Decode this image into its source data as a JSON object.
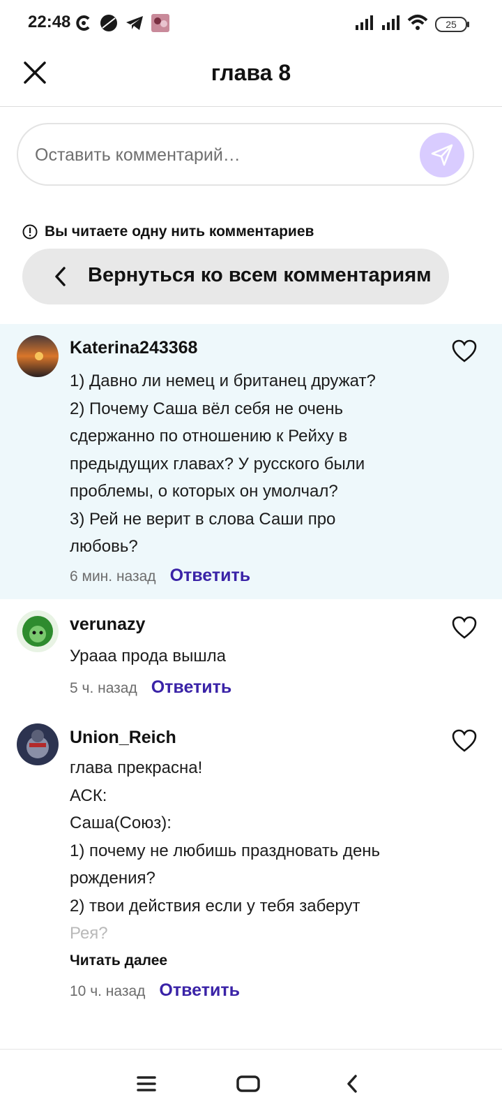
{
  "status_bar": {
    "time": "22:48",
    "battery": "25",
    "icons_left": [
      "c-app-icon",
      "globe-icon",
      "telegram-icon",
      "app-thumbnail-icon"
    ],
    "icons_right": [
      "signal-icon",
      "signal-icon",
      "wifi-icon",
      "battery-icon"
    ]
  },
  "header": {
    "title": "глава 8"
  },
  "comment_input": {
    "placeholder": "Оставить комментарий…"
  },
  "thread_notice": {
    "text": "Вы читаете одну нить комментариев",
    "back_label": "Вернуться ко всем комментариям"
  },
  "comments": [
    {
      "user": "Katerina243368",
      "lines": [
        "1) Давно ли немец и британец дружат?",
        "2) Почему Саша вёл себя не очень",
        "сдержанно по отношению к Рейху в",
        "предыдущих главах? У русского были",
        "проблемы, о которых он умолчал?",
        "3) Рей не верит в слова Саши про",
        "любовь?"
      ],
      "time": "6 мин. назад",
      "reply": "Ответить"
    },
    {
      "user": "verunazy",
      "lines": [
        "Урааа прода вышла"
      ],
      "time": "5 ч. назад",
      "reply": "Ответить"
    },
    {
      "user": "Union_Reich",
      "lines": [
        "глава прекрасна!",
        "АСК:",
        "Саша(Союз):",
        "1) почему не любишь праздновать день",
        "рождения?",
        "2) твои действия если у тебя заберут",
        "Рея?"
      ],
      "read_more": "Читать далее",
      "time": "10 ч. назад",
      "reply": "Ответить"
    }
  ],
  "colors": {
    "accent": "#3a23a7",
    "send_button": "#d9ccff",
    "highlight_bg": "#eef8fb",
    "pill_bg": "#e8e8e8"
  }
}
